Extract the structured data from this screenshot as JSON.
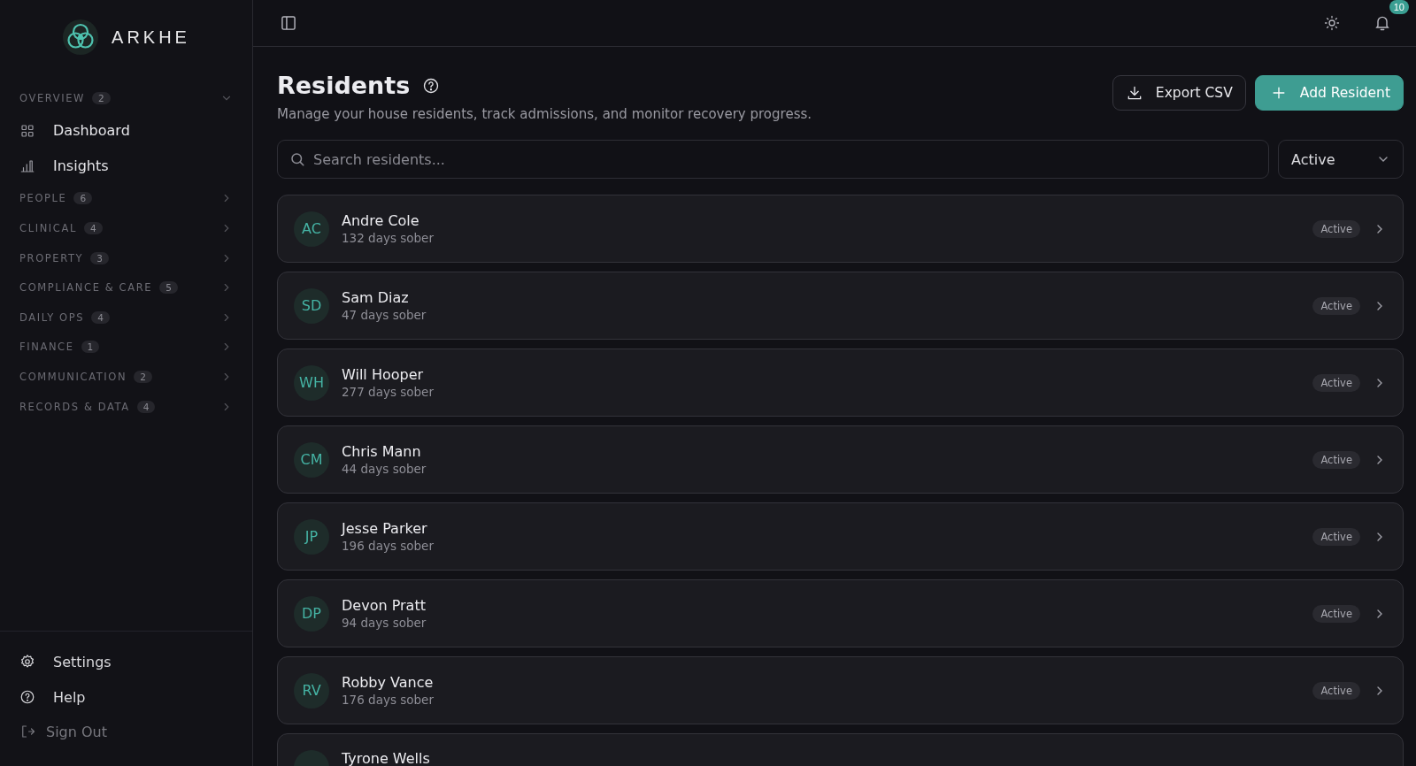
{
  "brand": {
    "name": "ARKHE"
  },
  "sidebar": {
    "sections": [
      {
        "label": "OVERVIEW",
        "count": "2",
        "expanded": true,
        "items": [
          {
            "label": "Dashboard",
            "kind": "grid"
          },
          {
            "label": "Insights",
            "kind": "chart"
          }
        ]
      },
      {
        "label": "PEOPLE",
        "count": "6",
        "expanded": false
      },
      {
        "label": "CLINICAL",
        "count": "4",
        "expanded": false
      },
      {
        "label": "PROPERTY",
        "count": "3",
        "expanded": false
      },
      {
        "label": "COMPLIANCE & CARE",
        "count": "5",
        "expanded": false
      },
      {
        "label": "DAILY OPS",
        "count": "4",
        "expanded": false
      },
      {
        "label": "FINANCE",
        "count": "1",
        "expanded": false
      },
      {
        "label": "COMMUNICATION",
        "count": "2",
        "expanded": false
      },
      {
        "label": "RECORDS & DATA",
        "count": "4",
        "expanded": false
      }
    ],
    "footer": [
      {
        "label": "Settings",
        "kind": "settings"
      },
      {
        "label": "Help",
        "kind": "help"
      },
      {
        "label": "Sign Out",
        "kind": "signout"
      }
    ]
  },
  "topbar": {
    "notifications": "10"
  },
  "page": {
    "title": "Residents",
    "subtitle": "Manage your house residents, track admissions, and monitor recovery progress.",
    "buttons": [
      {
        "label": "Export CSV",
        "kind": "export"
      },
      {
        "label": "Add Resident",
        "kind": "add"
      }
    ]
  },
  "search": {
    "placeholder": "Search residents..."
  },
  "filter": {
    "value": "Active"
  },
  "residents": [
    {
      "initials": "AC",
      "name": "Andre Cole",
      "detail": "132 days sober",
      "status": "Active"
    },
    {
      "initials": "SD",
      "name": "Sam Diaz",
      "detail": "47 days sober",
      "status": "Active"
    },
    {
      "initials": "WH",
      "name": "Will Hooper",
      "detail": "277 days sober",
      "status": "Active"
    },
    {
      "initials": "CM",
      "name": "Chris Mann",
      "detail": "44 days sober",
      "status": "Active"
    },
    {
      "initials": "JP",
      "name": "Jesse Parker",
      "detail": "196 days sober",
      "status": "Active"
    },
    {
      "initials": "DP",
      "name": "Devon Pratt",
      "detail": "94 days sober",
      "status": "Active"
    },
    {
      "initials": "RV",
      "name": "Robby Vance",
      "detail": "176 days sober",
      "status": "Active"
    },
    {
      "name": "Tyrone Wells"
    }
  ]
}
